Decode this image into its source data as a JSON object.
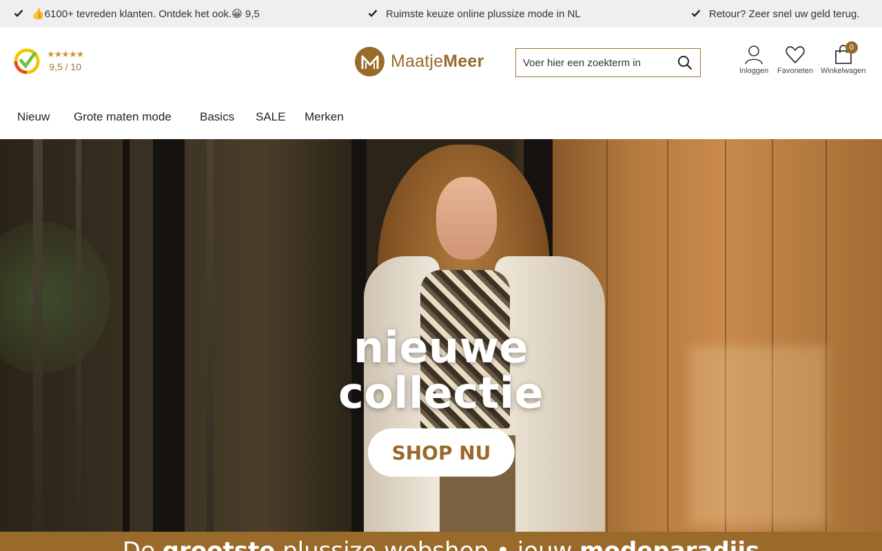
{
  "usp_bar": {
    "items": [
      {
        "text": "👍6100+ tevreden klanten. Ontdek het ook.😀 9,5",
        "icon": "check-icon"
      },
      {
        "text": "Ruimste keuze online plussize mode in NL",
        "icon": "check-icon"
      },
      {
        "text": "Retour? Zeer snel uw geld terug.",
        "icon": "check-icon"
      }
    ]
  },
  "header": {
    "rating": {
      "stars": "★★★★★",
      "score": "9,5 / 10",
      "star_count": 5
    },
    "logo": {
      "name_part1": "Maatje",
      "name_part2": "Meer"
    },
    "search": {
      "placeholder": "Voer hier een zoekterm in"
    },
    "actions": {
      "login_label": "Inloggen",
      "favorites_label": "Favorieten",
      "cart_label": "Winkelwagen",
      "cart_count": "0"
    }
  },
  "nav": {
    "items": [
      "Nieuw",
      "Grote maten mode",
      "Basics",
      "SALE",
      "Merken"
    ]
  },
  "hero": {
    "title_line1": "nieuwe",
    "title_line2": "collectie",
    "button_label": "SHOP NU"
  },
  "bottom_banner": {
    "part1": "De ",
    "part2": "grootste",
    "part3": " plussize webshop • jouw ",
    "part4": "modeparadijs"
  },
  "colors": {
    "brand": "#9a6a2a",
    "usp_bar_bg": "#efefef",
    "star": "#c79a2a"
  }
}
